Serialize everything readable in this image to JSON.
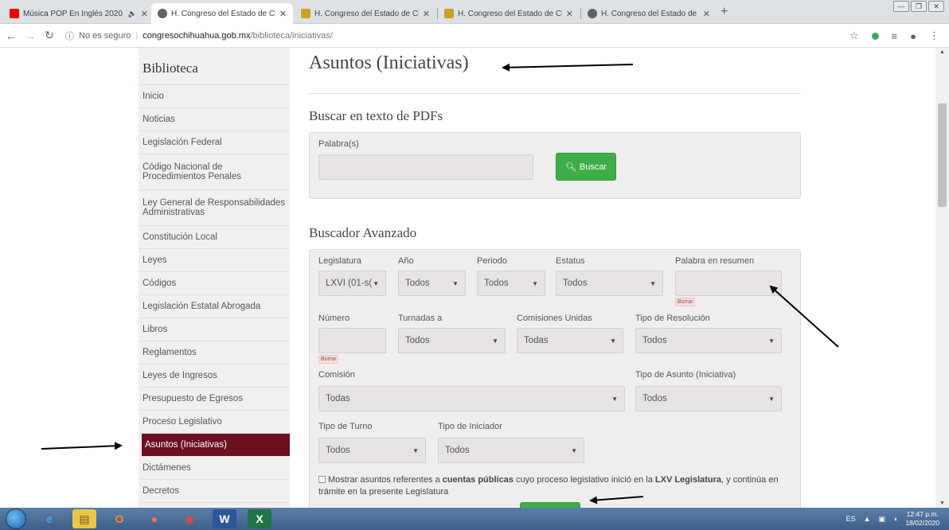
{
  "browser": {
    "tabs": [
      {
        "label": "Música POP En Inglés 2020 -",
        "icon": "youtube-icon",
        "extra": "🔈",
        "active": false
      },
      {
        "label": "H. Congreso del Estado de Chihu",
        "icon": "globe-icon",
        "active": true
      },
      {
        "label": "H. Congreso del Estado de Chihu",
        "icon": "congress-logo-icon",
        "active": false
      },
      {
        "label": "H. Congreso del Estado de Chihu",
        "icon": "congress-logo-icon",
        "active": false
      },
      {
        "label": "H. Congreso del Estado de Chihu",
        "icon": "globe-icon",
        "active": false
      }
    ],
    "security_text": "No es seguro",
    "url_host": "congresochihuahua.gob.mx",
    "url_path": "/biblioteca/iniciativas/"
  },
  "sidebar": {
    "title": "Biblioteca",
    "items": [
      {
        "label": "Inicio"
      },
      {
        "label": "Noticias"
      },
      {
        "label": "Legislación Federal"
      },
      {
        "label": "Código Nacional de Procedimientos Penales"
      },
      {
        "label": "Ley General de Responsabilidades Administrativas"
      },
      {
        "label": "Constitución Local"
      },
      {
        "label": "Leyes"
      },
      {
        "label": "Códigos"
      },
      {
        "label": "Legislación Estatal Abrogada"
      },
      {
        "label": "Libros"
      },
      {
        "label": "Reglamentos"
      },
      {
        "label": "Leyes de Ingresos"
      },
      {
        "label": "Presupuesto de Egresos"
      },
      {
        "label": "Proceso Legislativo"
      },
      {
        "label": "Asuntos (Iniciativas)"
      },
      {
        "label": "Dictámenes"
      },
      {
        "label": "Decretos"
      }
    ],
    "active_index": 14
  },
  "main": {
    "title": "Asuntos (Iniciativas)",
    "pdf_search": {
      "heading": "Buscar en texto de PDFs",
      "label": "Palabra(s)",
      "value": "",
      "button": "Buscar"
    },
    "advanced": {
      "heading": "Buscador Avanzado",
      "legislatura": {
        "label": "Legislatura",
        "value": "LXVI (01-s("
      },
      "anio": {
        "label": "Año",
        "value": "Todos"
      },
      "periodo": {
        "label": "Periodo",
        "value": "Todos"
      },
      "estatus": {
        "label": "Estatus",
        "value": "Todos"
      },
      "palabra_resumen": {
        "label": "Palabra en resumen",
        "value": ""
      },
      "borrar": "Borrar",
      "numero": {
        "label": "Número",
        "value": ""
      },
      "turnadas": {
        "label": "Turnadas a",
        "value": "Todos"
      },
      "comisiones_unidas": {
        "label": "Comisiones Unidas",
        "value": "Todas"
      },
      "tipo_resolucion": {
        "label": "Tipo de Resolución",
        "value": "Todos"
      },
      "comision": {
        "label": "Comisión",
        "value": "Todas"
      },
      "tipo_asunto": {
        "label": "Tipo de Asunto (Iniciativa)",
        "value": "Todos"
      },
      "tipo_turno": {
        "label": "Tipo de Turno",
        "value": "Todos"
      },
      "tipo_iniciador": {
        "label": "Tipo de Iniciador",
        "value": "Todos"
      },
      "checkbox": {
        "prefix": "Mostrar asuntos referentes a ",
        "bold1": "cuentas públicas",
        "middle": " cuyo proceso legislativo inició en la ",
        "bold2": "LXV Legislatura",
        "suffix": ", y continúa en trámite en la presente Legislatura",
        "checked": false
      }
    }
  },
  "taskbar": {
    "language": "ES",
    "time": "12:47 p.m.",
    "date": "18/02/2020"
  }
}
